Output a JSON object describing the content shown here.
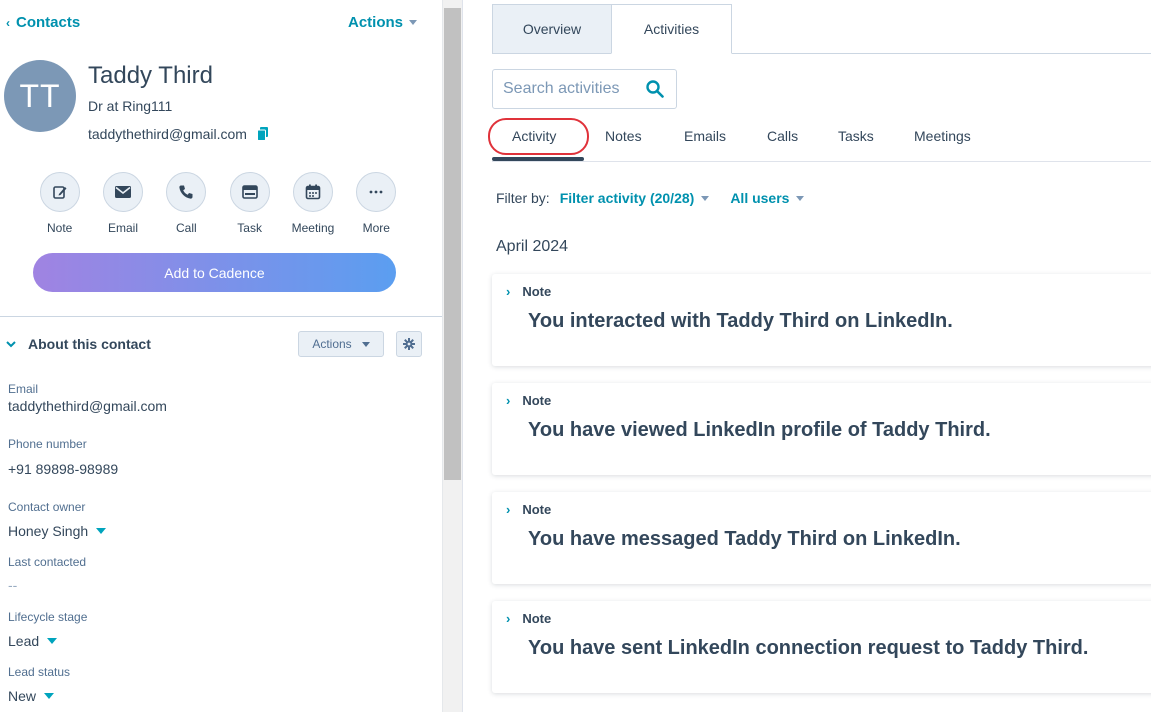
{
  "header": {
    "back_label": "Contacts",
    "actions_label": "Actions"
  },
  "contact": {
    "initials": "TT",
    "name": "Taddy Third",
    "title": "Dr at Ring111",
    "email": "taddythethird@gmail.com"
  },
  "quick_actions": [
    {
      "label": "Note",
      "icon": "pencil-icon"
    },
    {
      "label": "Email",
      "icon": "envelope-icon"
    },
    {
      "label": "Call",
      "icon": "phone-icon"
    },
    {
      "label": "Task",
      "icon": "task-icon"
    },
    {
      "label": "Meeting",
      "icon": "calendar-icon"
    },
    {
      "label": "More",
      "icon": "more-icon"
    }
  ],
  "cadence_button": "Add to Cadence",
  "about": {
    "title": "About this contact",
    "actions_label": "Actions",
    "properties": [
      {
        "label": "Email",
        "value": "taddythethird@gmail.com"
      },
      {
        "label": "Phone number",
        "value": "+91 89898-98989"
      },
      {
        "label": "Contact owner",
        "value": "Honey Singh"
      },
      {
        "label": "Last contacted",
        "value": "--"
      },
      {
        "label": "Lifecycle stage",
        "value": "Lead"
      },
      {
        "label": "Lead status",
        "value": "New"
      }
    ]
  },
  "main_tabs": [
    {
      "label": "Overview"
    },
    {
      "label": "Activities"
    }
  ],
  "search": {
    "placeholder": "Search activities"
  },
  "sub_tabs": [
    {
      "label": "Activity"
    },
    {
      "label": "Notes"
    },
    {
      "label": "Emails"
    },
    {
      "label": "Calls"
    },
    {
      "label": "Tasks"
    },
    {
      "label": "Meetings"
    }
  ],
  "filter": {
    "label": "Filter by:",
    "activity": "Filter activity (20/28)",
    "users": "All users"
  },
  "month": "April 2024",
  "activities": [
    {
      "type": "Note",
      "text": "You interacted with Taddy Third on LinkedIn."
    },
    {
      "type": "Note",
      "text": "You have viewed LinkedIn profile of Taddy Third."
    },
    {
      "type": "Note",
      "text": "You have messaged Taddy Third on LinkedIn."
    },
    {
      "type": "Note",
      "text": "You have sent LinkedIn connection request to Taddy Third."
    }
  ],
  "colors": {
    "accent": "#0091ae",
    "text": "#33475b",
    "active_outline": "#e0323a",
    "avatar": "#7c98b6"
  }
}
